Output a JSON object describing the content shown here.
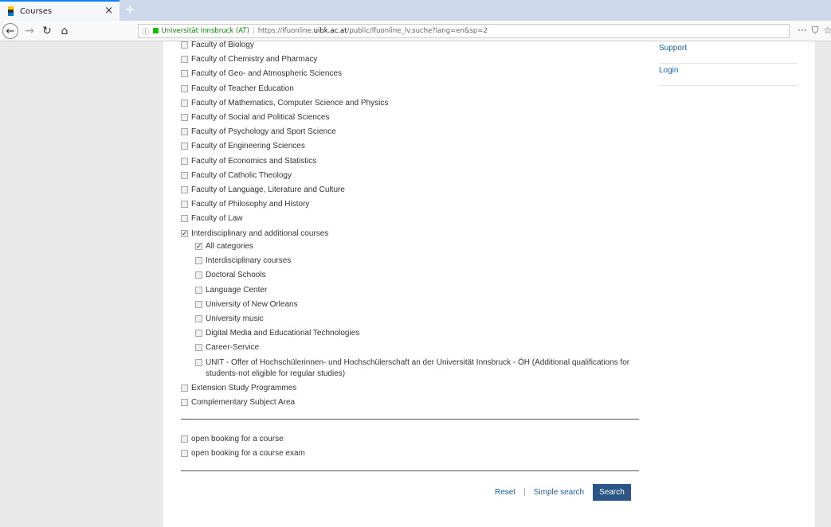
{
  "browser": {
    "tab_title": "Courses",
    "tab_close": "×",
    "new_tab": "+",
    "url_info": "ⓘ",
    "url_lock": "🔒",
    "url_org": "Universität Innsbruck (AT)",
    "url_prefix": "https://lfuonline.",
    "url_host": "uibk.ac.at",
    "url_suffix": "/public/lfuonline_lv.suche?lang=en&sp=2",
    "toolbar_more": "···",
    "pocket": "⛉",
    "star": "☆"
  },
  "faculties": [
    {
      "label": "Faculty of Biology",
      "checked": false
    },
    {
      "label": "Faculty of Chemistry and Pharmacy",
      "checked": false
    },
    {
      "label": "Faculty of Geo- and Atmospheric Sciences",
      "checked": false
    },
    {
      "label": "Faculty of Teacher Education",
      "checked": false
    },
    {
      "label": "Faculty of Mathematics, Computer Science and Physics",
      "checked": false
    },
    {
      "label": "Faculty of Social and Political Sciences",
      "checked": false
    },
    {
      "label": "Faculty of Psychology and Sport Science",
      "checked": false
    },
    {
      "label": "Faculty of Engineering Sciences",
      "checked": false
    },
    {
      "label": "Faculty of Economics and Statistics",
      "checked": false
    },
    {
      "label": "Faculty of Catholic Theology",
      "checked": false
    },
    {
      "label": "Faculty of Language, Literature and Culture",
      "checked": false
    },
    {
      "label": "Faculty of Philosophy and History",
      "checked": false
    },
    {
      "label": "Faculty of Law",
      "checked": false
    },
    {
      "label": "Interdisciplinary and additional courses",
      "checked": true
    }
  ],
  "subcategories": [
    {
      "label": "All categories",
      "checked": true
    },
    {
      "label": "Interdisciplinary courses",
      "checked": false
    },
    {
      "label": "Doctoral Schools",
      "checked": false
    },
    {
      "label": "Language Center",
      "checked": false
    },
    {
      "label": "University of New Orleans",
      "checked": false
    },
    {
      "label": "University music",
      "checked": false
    },
    {
      "label": "Digital Media and Educational Technologies",
      "checked": false
    },
    {
      "label": "Career-Service",
      "checked": false
    },
    {
      "label": "UNIT - Offer of Hochschülerinnen- und Hochschülerschaft an der Universität Innsbruck - ÖH (Additional qualifications for students-not eligible for regular studies)",
      "checked": false
    }
  ],
  "more_areas": [
    {
      "label": "Extension Study Programmes",
      "checked": false
    },
    {
      "label": "Complementary Subject Area",
      "checked": false
    }
  ],
  "booking_options": [
    {
      "label": "open booking for a course",
      "checked": false
    },
    {
      "label": "open booking for a course exam",
      "checked": false
    }
  ],
  "actions": {
    "reset": "Reset",
    "separator": "|",
    "simple_search": "Simple search",
    "search": "Search"
  },
  "sidebar": {
    "support": "Support",
    "login": "Login"
  }
}
